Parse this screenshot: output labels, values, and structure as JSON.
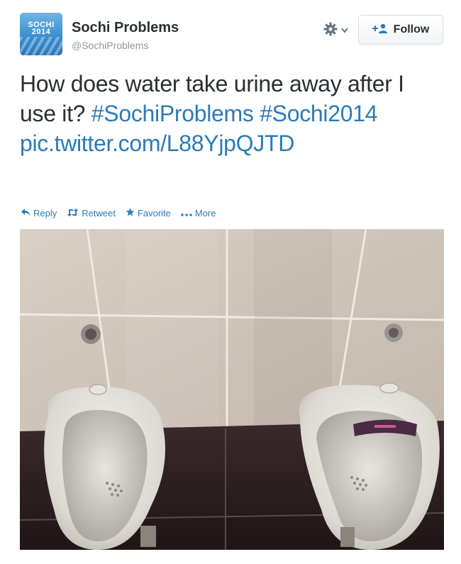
{
  "account": {
    "display_name": "Sochi Problems",
    "username": "@SochiProblems",
    "avatar_text": "SOCHI 2014"
  },
  "header": {
    "follow_label": "Follow",
    "menu_icon": "gear-icon"
  },
  "tweet": {
    "text_plain": "How does water take urine away after I use it?",
    "hashtag_1": "#SochiProblems",
    "hashtag_2": "#Sochi2014",
    "link": "pic.twitter.com/L88YjpQJTD"
  },
  "actions": {
    "reply": "Reply",
    "retweet": "Retweet",
    "favorite": "Favorite",
    "more": "More"
  },
  "colors": {
    "link": "#2b7bb9",
    "text": "#292f33",
    "muted": "#8899a6"
  }
}
